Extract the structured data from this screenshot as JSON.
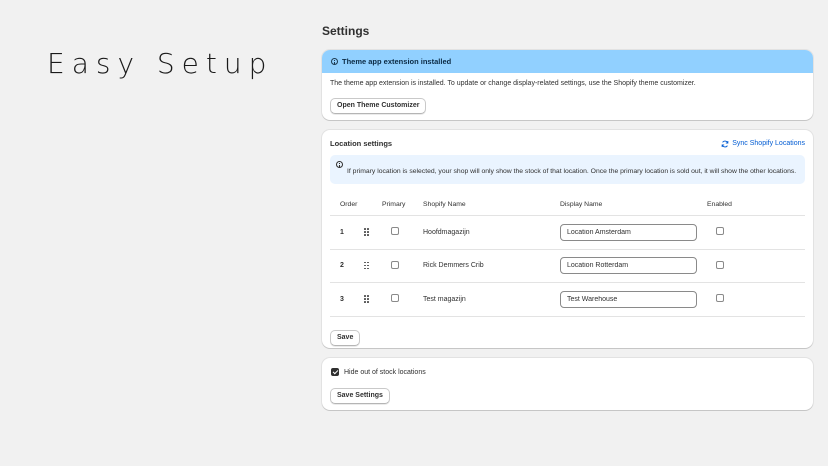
{
  "hero": {
    "title": "Easy Setup"
  },
  "page": {
    "title": "Settings"
  },
  "theme_card": {
    "banner_title": "Theme app extension installed",
    "body_text": "The theme app extension is installed. To update or change display-related settings, use the Shopify theme customizer.",
    "button_label": "Open Theme Customizer",
    "banner_color": "#91d0ff"
  },
  "location_card": {
    "title": "Location settings",
    "sync_label": "Sync Shopify Locations",
    "notice_text": "If primary location is selected, your shop will only show the stock of that location. Once the primary location is sold out, it will show the other locations.",
    "columns": {
      "order": "Order",
      "primary": "Primary",
      "shopify_name": "Shopify Name",
      "display_name": "Display Name",
      "enabled": "Enabled"
    },
    "rows": [
      {
        "order": "1",
        "shopify_name": "Hoofdmagazijn",
        "display_name": "Location Amsterdam",
        "primary": false,
        "enabled": false
      },
      {
        "order": "2",
        "shopify_name": "Rick Demmers Crib",
        "display_name": "Location Rotterdam",
        "primary": false,
        "enabled": false
      },
      {
        "order": "3",
        "shopify_name": "Test magazijn",
        "display_name": "Test Warehouse",
        "primary": false,
        "enabled": false
      }
    ],
    "save_label": "Save",
    "link_color": "#005bd3"
  },
  "hide_card": {
    "checkbox_label": "Hide out of stock locations",
    "checked": true,
    "button_label": "Save Settings"
  }
}
